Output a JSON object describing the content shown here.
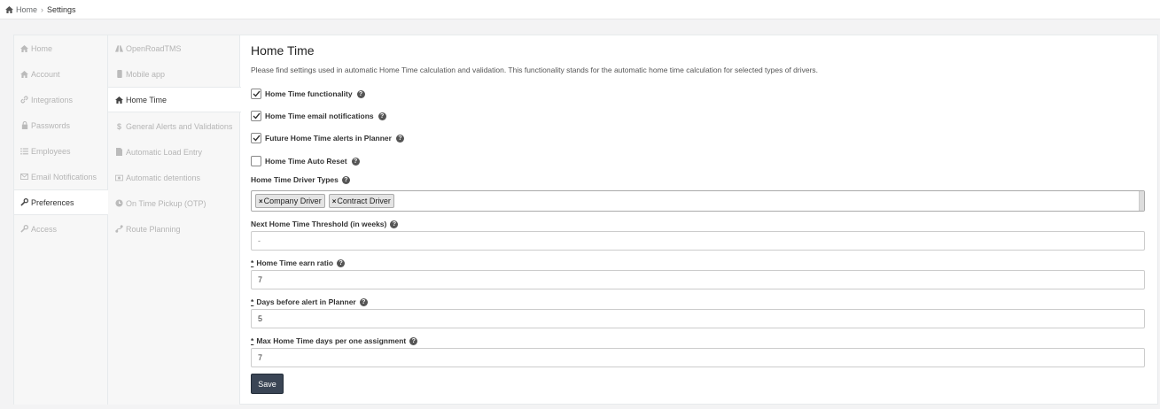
{
  "breadcrumb": {
    "home": "Home",
    "current": "Settings"
  },
  "nav_primary": [
    {
      "label": "Home",
      "icon": "home-icon",
      "active": false
    },
    {
      "label": "Account",
      "icon": "home-icon",
      "active": false
    },
    {
      "label": "Integrations",
      "icon": "link-icon",
      "active": false
    },
    {
      "label": "Passwords",
      "icon": "lock-icon",
      "active": false
    },
    {
      "label": "Employees",
      "icon": "list-icon",
      "active": false
    },
    {
      "label": "Email Notifications",
      "icon": "envelope-icon",
      "active": false
    },
    {
      "label": "Preferences",
      "icon": "wrench-icon",
      "active": true
    },
    {
      "label": "Access",
      "icon": "wrench-icon",
      "active": false
    }
  ],
  "nav_secondary": [
    {
      "label": "OpenRoadTMS",
      "icon": "road-icon",
      "active": false
    },
    {
      "label": "Mobile app",
      "icon": "mobile-icon",
      "active": false
    },
    {
      "label": "Home Time",
      "icon": "home-icon",
      "active": true
    },
    {
      "label": "General Alerts and Validations",
      "icon": "dollar-icon",
      "active": false
    },
    {
      "label": "Automatic Load Entry",
      "icon": "file-icon",
      "active": false
    },
    {
      "label": "Automatic detentions",
      "icon": "money-icon",
      "active": false
    },
    {
      "label": "On Time Pickup (OTP)",
      "icon": "clock-icon",
      "active": false
    },
    {
      "label": "Route Planning",
      "icon": "route-icon",
      "active": false
    }
  ],
  "page": {
    "title": "Home Time",
    "description": "Please find settings used in automatic Home Time calculation and validation. This functionality stands for the automatic home time calculation for selected types of drivers."
  },
  "checkboxes": [
    {
      "label": "Home Time functionality",
      "checked": true
    },
    {
      "label": "Home Time email notifications",
      "checked": true
    },
    {
      "label": "Future Home Time alerts in Planner",
      "checked": true
    },
    {
      "label": "Home Time Auto Reset",
      "checked": false
    }
  ],
  "driver_types": {
    "label": "Home Time Driver Types",
    "tags": [
      "Company Driver",
      "Contract Driver"
    ]
  },
  "fields": [
    {
      "label": "Next Home Time Threshold (in weeks)",
      "required": false,
      "value": "-"
    },
    {
      "label": "Home Time earn ratio",
      "required": true,
      "value": "7"
    },
    {
      "label": "Days before alert in Planner",
      "required": true,
      "value": "5"
    },
    {
      "label": "Max Home Time days per one assignment",
      "required": true,
      "value": "7"
    }
  ],
  "required_mark": "*",
  "help_glyph": "?",
  "tag_remove_glyph": "×",
  "save_label": "Save",
  "colors": {
    "save_button": "#3a4555",
    "active_text": "#333333",
    "inactive_text": "#b5b5b5"
  }
}
